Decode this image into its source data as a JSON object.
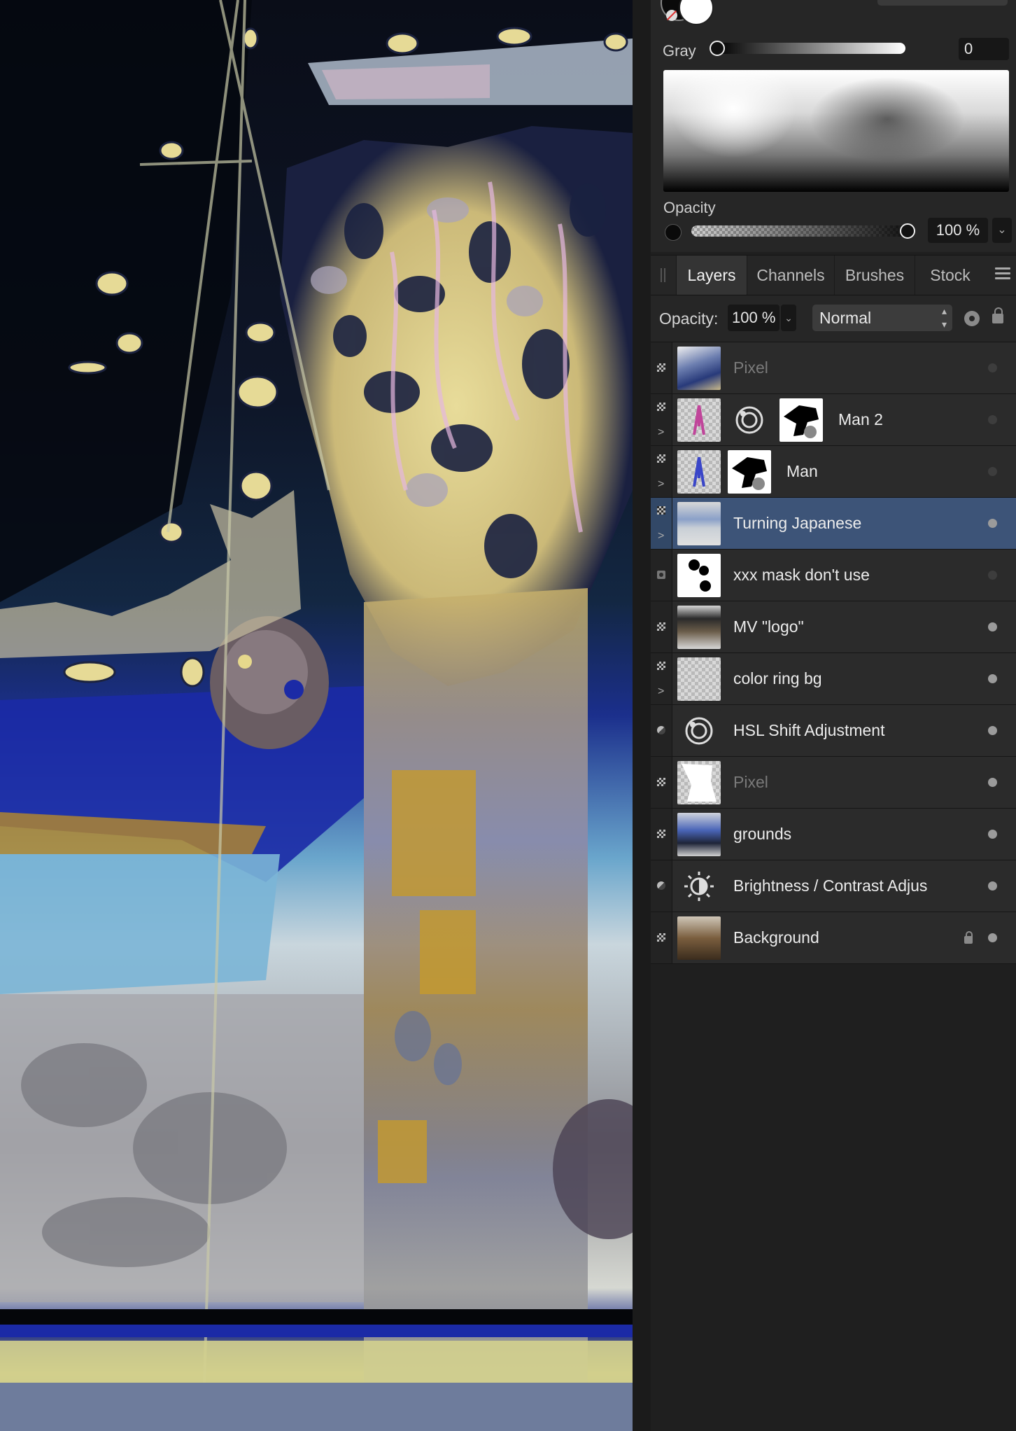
{
  "color_panel": {
    "gray_label": "Gray",
    "gray_value": "0",
    "opacity_label": "Opacity",
    "opacity_value": "100 %",
    "gray_level": 0,
    "opacity_level": 1.0
  },
  "tabs": [
    {
      "label": "Layers",
      "active": true
    },
    {
      "label": "Channels",
      "active": false
    },
    {
      "label": "Brushes",
      "active": false
    },
    {
      "label": "Stock",
      "active": false
    }
  ],
  "layer_toolbar": {
    "opacity_label": "Opacity:",
    "opacity_value": "100 %",
    "blend_mode": "Normal"
  },
  "layers": [
    {
      "name": "Pixel",
      "type": "pixel",
      "dimmed": true,
      "visible": false,
      "expandable": false,
      "selected": false,
      "locked": false,
      "thumb": "photo-collage",
      "extra_icons": []
    },
    {
      "name": "Man 2",
      "type": "pixel",
      "dimmed": false,
      "visible": false,
      "expandable": true,
      "selected": false,
      "locked": false,
      "thumb": "figure-pink",
      "extra_icons": [
        "hsl-adjustment-icon",
        "mask-thumb"
      ]
    },
    {
      "name": "Man",
      "type": "pixel",
      "dimmed": false,
      "visible": false,
      "expandable": true,
      "selected": false,
      "locked": false,
      "thumb": "figure-blue",
      "extra_icons": [
        "mask-thumb"
      ]
    },
    {
      "name": "Turning Japanese",
      "type": "pixel",
      "dimmed": false,
      "visible": true,
      "expandable": true,
      "selected": true,
      "locked": false,
      "thumb": "collage",
      "extra_icons": []
    },
    {
      "name": "xxx mask don't use",
      "type": "mask",
      "dimmed": false,
      "visible": false,
      "expandable": false,
      "selected": false,
      "locked": false,
      "thumb": "mask-blobs",
      "extra_icons": []
    },
    {
      "name": "MV \"logo\"",
      "type": "pixel",
      "dimmed": false,
      "visible": true,
      "expandable": false,
      "selected": false,
      "locked": false,
      "thumb": "logo",
      "extra_icons": []
    },
    {
      "name": "color ring bg",
      "type": "pixel",
      "dimmed": false,
      "visible": true,
      "expandable": true,
      "selected": false,
      "locked": false,
      "thumb": "transparent",
      "extra_icons": []
    },
    {
      "name": "HSL Shift Adjustment",
      "type": "adjustment",
      "dimmed": false,
      "visible": true,
      "expandable": false,
      "selected": false,
      "locked": false,
      "thumb": "hsl-icon",
      "extra_icons": []
    },
    {
      "name": "Pixel",
      "type": "pixel",
      "dimmed": true,
      "visible": true,
      "expandable": false,
      "selected": false,
      "locked": false,
      "thumb": "white-shape",
      "extra_icons": []
    },
    {
      "name": "grounds",
      "type": "pixel",
      "dimmed": false,
      "visible": true,
      "expandable": false,
      "selected": false,
      "locked": false,
      "thumb": "grounds",
      "extra_icons": []
    },
    {
      "name": "Brightness / Contrast Adjus",
      "type": "adjustment",
      "dimmed": false,
      "visible": true,
      "expandable": false,
      "selected": false,
      "locked": false,
      "thumb": "brightness-icon",
      "extra_icons": []
    },
    {
      "name": "Background",
      "type": "pixel",
      "dimmed": false,
      "visible": true,
      "expandable": false,
      "selected": false,
      "locked": true,
      "thumb": "background",
      "extra_icons": []
    }
  ],
  "colors": {
    "selected_row": "#3d5478",
    "panel_bg": "#262626",
    "row_bg": "#2b2b2b"
  }
}
